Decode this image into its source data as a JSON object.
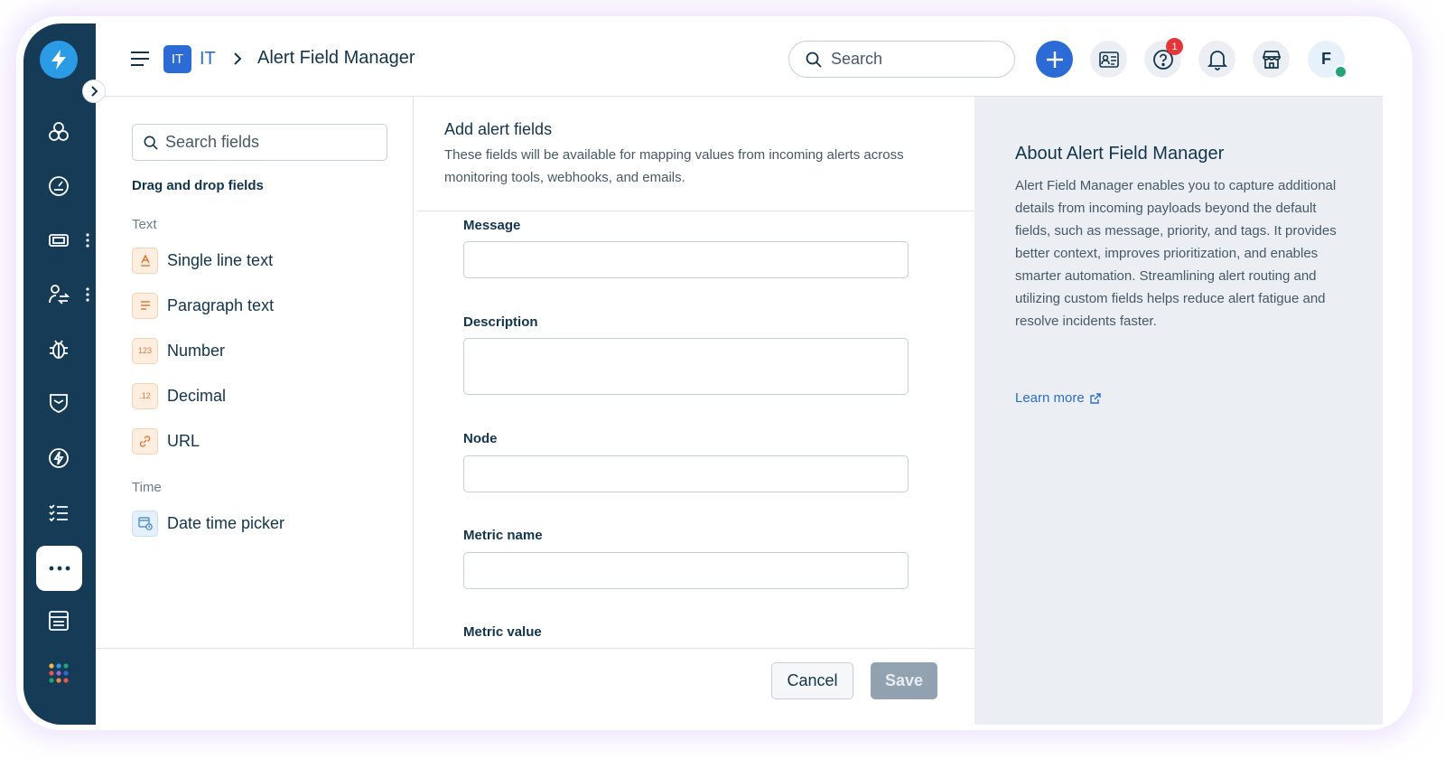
{
  "colors": {
    "rail": "#163b56",
    "accent": "#2c6bd6",
    "danger": "#e43538",
    "online": "#22a37a",
    "save_disabled": "#92a2b1"
  },
  "header": {
    "workspace_badge": "IT",
    "workspace_name": "IT",
    "page_title": "Alert Field Manager",
    "search_placeholder": "Search",
    "notification_count": "1",
    "avatar_initial": "F"
  },
  "rail": {
    "icons": [
      "logo-icon",
      "incidents-icon",
      "dashboard-icon",
      "tickets-icon",
      "changes-icon",
      "bug-icon",
      "shield-icon",
      "alerts-icon",
      "checklist-icon",
      "more-icon",
      "console-icon",
      "apps-icon"
    ]
  },
  "palette": {
    "search_placeholder": "Search fields",
    "title": "Drag and drop fields",
    "groups": [
      {
        "label": "Text",
        "items": [
          {
            "label": "Single line text",
            "icon": "single-line-text-icon"
          },
          {
            "label": "Paragraph text",
            "icon": "paragraph-text-icon"
          },
          {
            "label": "Number",
            "icon": "number-icon",
            "glyph": "123"
          },
          {
            "label": "Decimal",
            "icon": "decimal-icon",
            "glyph": ".12"
          },
          {
            "label": "URL",
            "icon": "link-icon"
          }
        ]
      },
      {
        "label": "Time",
        "items": [
          {
            "label": "Date time picker",
            "icon": "date-time-icon"
          }
        ]
      }
    ]
  },
  "form": {
    "title": "Add alert fields",
    "description": "These fields will be available for mapping values from incoming alerts across monitoring tools, webhooks, and emails.",
    "fields": [
      {
        "label": "Message"
      },
      {
        "label": "Description"
      },
      {
        "label": "Node"
      },
      {
        "label": "Metric name"
      },
      {
        "label": "Metric value"
      }
    ]
  },
  "footer": {
    "cancel_label": "Cancel",
    "save_label": "Save"
  },
  "info": {
    "title": "About Alert Field Manager",
    "body": "Alert Field Manager enables you to capture additional details from incoming payloads beyond the default fields, such as message, priority, and tags. It provides better context, improves prioritization, and enables smarter automation. Streamlining alert routing and utilizing custom fields helps reduce alert fatigue and resolve incidents faster.",
    "learn_more": "Learn more"
  }
}
